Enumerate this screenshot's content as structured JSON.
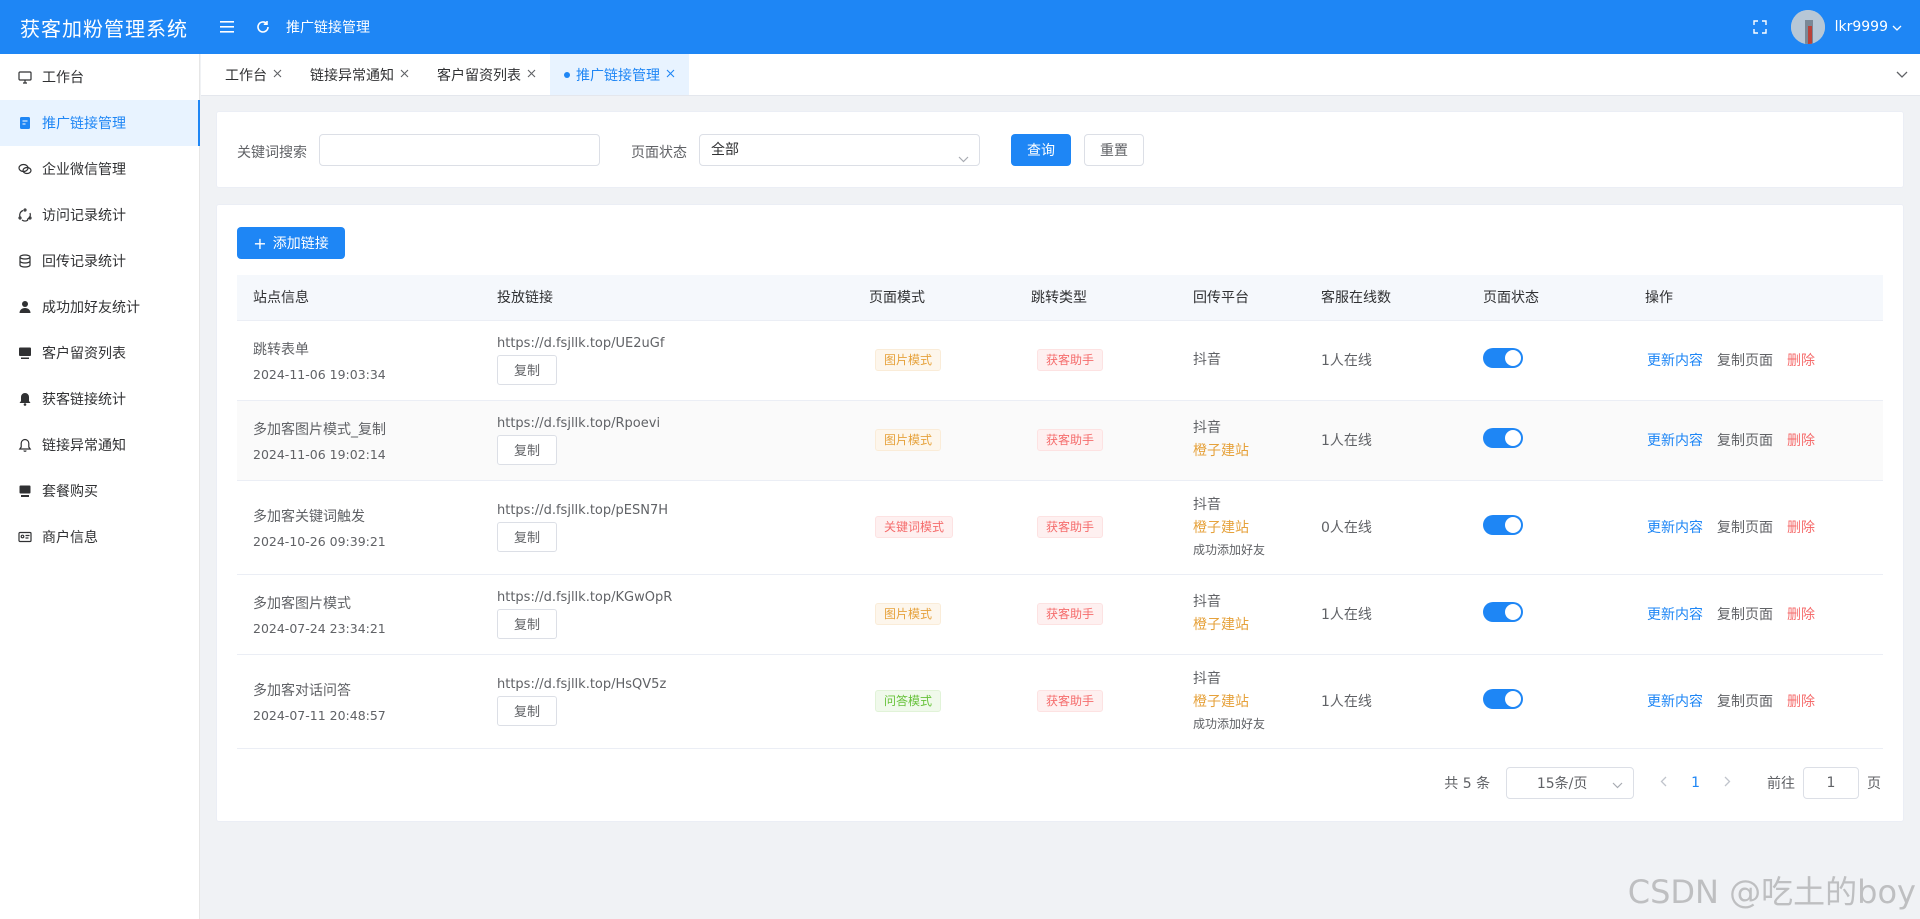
{
  "app": {
    "brand": "获客加粉管理系统",
    "header_title": "推广链接管理",
    "username": "lkr9999"
  },
  "sidebar": {
    "items": [
      {
        "label": "工作台",
        "icon": "monitor-icon",
        "active": false
      },
      {
        "label": "推广链接管理",
        "icon": "document-icon",
        "active": true
      },
      {
        "label": "企业微信管理",
        "icon": "chat-icon",
        "active": false
      },
      {
        "label": "访问记录统计",
        "icon": "cycle-icon",
        "active": false
      },
      {
        "label": "回传记录统计",
        "icon": "database-icon",
        "active": false
      },
      {
        "label": "成功加好友统计",
        "icon": "user-icon",
        "active": false
      },
      {
        "label": "客户留资列表",
        "icon": "screen-icon",
        "active": false
      },
      {
        "label": "获客链接统计",
        "icon": "bell-filled-icon",
        "active": false
      },
      {
        "label": "链接异常通知",
        "icon": "bell-icon",
        "active": false
      },
      {
        "label": "套餐购买",
        "icon": "wallet-icon",
        "active": false
      },
      {
        "label": "商户信息",
        "icon": "id-card-icon",
        "active": false
      }
    ]
  },
  "tabs": [
    {
      "label": "工作台",
      "active": false
    },
    {
      "label": "链接异常通知",
      "active": false
    },
    {
      "label": "客户留资列表",
      "active": false
    },
    {
      "label": "推广链接管理",
      "active": true
    }
  ],
  "search": {
    "keyword_label": "关键词搜索",
    "keyword_value": "",
    "status_label": "页面状态",
    "status_value": "全部",
    "query_label": "查询",
    "reset_label": "重置"
  },
  "main": {
    "add_label": "添加链接",
    "columns": [
      "站点信息",
      "投放链接",
      "页面模式",
      "跳转类型",
      "回传平台",
      "客服在线数",
      "页面状态",
      "操作"
    ],
    "copy_label": "复制",
    "rows": [
      {
        "name": "跳转表单",
        "time": "2024-11-06 19:03:34",
        "url": "https://d.fsjllk.top/UE2uGf",
        "mode": "图片模式",
        "mode_type": "warn",
        "jump": "获客助手",
        "platforms": [
          "抖音"
        ],
        "extra": "",
        "online": "1人在线",
        "enabled": true
      },
      {
        "name": "多加客图片模式_复制",
        "time": "2024-11-06 19:02:14",
        "url": "https://d.fsjllk.top/Rpoevi",
        "mode": "图片模式",
        "mode_type": "warn",
        "jump": "获客助手",
        "platforms": [
          "抖音",
          "橙子建站"
        ],
        "extra": "",
        "online": "1人在线",
        "enabled": true
      },
      {
        "name": "多加客关键词触发",
        "time": "2024-10-26 09:39:21",
        "url": "https://d.fsjllk.top/pESN7H",
        "mode": "关键词模式",
        "mode_type": "danger",
        "jump": "获客助手",
        "platforms": [
          "抖音",
          "橙子建站"
        ],
        "extra": "成功添加好友",
        "online": "0人在线",
        "enabled": true
      },
      {
        "name": "多加客图片模式",
        "time": "2024-07-24 23:34:21",
        "url": "https://d.fsjllk.top/KGwOpR",
        "mode": "图片模式",
        "mode_type": "warn",
        "jump": "获客助手",
        "platforms": [
          "抖音",
          "橙子建站"
        ],
        "extra": "",
        "online": "1人在线",
        "enabled": true
      },
      {
        "name": "多加客对话问答",
        "time": "2024-07-11 20:48:57",
        "url": "https://d.fsjllk.top/HsQV5z",
        "mode": "问答模式",
        "mode_type": "success",
        "jump": "获客助手",
        "platforms": [
          "抖音",
          "橙子建站"
        ],
        "extra": "成功添加好友",
        "online": "1人在线",
        "enabled": true
      }
    ],
    "ops": {
      "update": "更新内容",
      "copy_page": "复制页面",
      "delete": "删除"
    }
  },
  "pagination": {
    "total": "共 5 条",
    "page_size": "15条/页",
    "current": "1",
    "goto_label": "前往",
    "goto_value": "1",
    "unit": "页"
  },
  "watermark": "CSDN @吃土的boy",
  "colors": {
    "primary": "#1e86f5",
    "warning": "#e6a23c",
    "danger": "#f56c6c",
    "success": "#67c23a"
  }
}
